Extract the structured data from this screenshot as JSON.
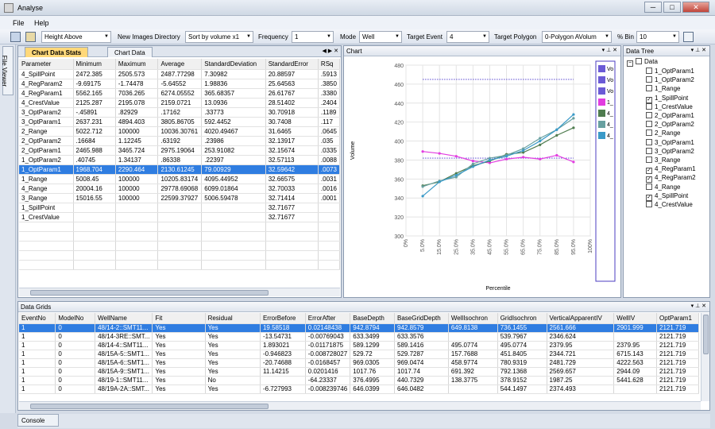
{
  "window": {
    "title": "Analyse",
    "min": "─",
    "max": "□",
    "close": "✕"
  },
  "menu": [
    "File",
    "Help"
  ],
  "toolbar": {
    "height_combo": "Height Above",
    "new_images_label": "New Images Directory",
    "sort_combo": "Sort by volume x1",
    "frequency_label": "Frequency",
    "frequency_combo": "1",
    "mode_label": "Mode",
    "mode_combo": "Well",
    "target_event_label": "Target Event",
    "target_event_combo": "4",
    "target_polygon_label": "Target Polygon",
    "target_polygon_combo": "0-Polygon AVolum",
    "bin_label": "% Bin",
    "bin_combo": "10"
  },
  "file_viewer": "File Viewer",
  "chart_data_panel": {
    "title": "Chart Data",
    "tabs": [
      "Chart Data Stats",
      "Chart Data"
    ],
    "columns": [
      "Parameter",
      "Minimum",
      "Maximum",
      "Average",
      "StandardDeviation",
      "StandardError",
      "RSq"
    ],
    "rows": [
      [
        "4_SpillPoint",
        "2472.385",
        "2505.573",
        "2487.77298",
        "7.30982",
        "20.88597",
        ".5913"
      ],
      [
        "4_RegParam2",
        "-9.69175",
        "-1.74478",
        "-5.64552",
        "1.98836",
        "25.64563",
        ".3850"
      ],
      [
        "4_RegParam1",
        "5562.165",
        "7036.265",
        "6274.05552",
        "365.68357",
        "26.61767",
        ".3380"
      ],
      [
        "4_CrestValue",
        "2125.287",
        "2195.078",
        "2159.0721",
        "13.0936",
        "28.51402",
        ".2404"
      ],
      [
        "3_OptParam2",
        "-.45891",
        ".82929",
        ".17162",
        ".33773",
        "30.70918",
        ".1189"
      ],
      [
        "3_OptParam1",
        "2637.231",
        "4894.403",
        "3805.86705",
        "592.4452",
        "30.7408",
        ".117"
      ],
      [
        "2_Range",
        "5022.712",
        "100000",
        "10036.30761",
        "4020.49467",
        "31.6465",
        ".0645"
      ],
      [
        "2_OptParam2",
        ".16684",
        "1.12245",
        ".63192",
        ".23986",
        "32.13917",
        ".035"
      ],
      [
        "2_OptParam1",
        "2465.988",
        "3465.724",
        "2975.19064",
        "253.91082",
        "32.15674",
        ".0335"
      ],
      [
        "1_OptParam2",
        ".40745",
        "1.34137",
        ".86338",
        ".22397",
        "32.57113",
        ".0088"
      ],
      [
        "1_OptParam1",
        "1968.704",
        "2290.464",
        "2130.61245",
        "79.00929",
        "32.59642",
        ".0073"
      ],
      [
        "1_Range",
        "5008.45",
        "100000",
        "10205.83174",
        "4095.44952",
        "32.66575",
        ".0031"
      ],
      [
        "4_Range",
        "20004.16",
        "100000",
        "29778.69068",
        "6099.01864",
        "32.70033",
        ".0016"
      ],
      [
        "3_Range",
        "15016.55",
        "100000",
        "22599.37927",
        "5006.59478",
        "32.71414",
        ".0001"
      ],
      [
        "1_SpillPoint",
        "",
        "",
        "",
        "",
        "32.71677",
        ""
      ],
      [
        "1_CrestValue",
        "",
        "",
        "",
        "",
        "32.71677",
        ""
      ]
    ],
    "selected_row": 10
  },
  "chart_panel": {
    "title": "Chart",
    "legend": [
      "Vo",
      "Vo",
      "Vo",
      "1_",
      "4_",
      "4_",
      "4_"
    ]
  },
  "chart_data": {
    "type": "line",
    "xlabel": "Percentile",
    "ylabel": "Volume",
    "x": [
      "0%",
      "5.0%",
      "15.0%",
      "25.0%",
      "35.0%",
      "45.0%",
      "55.0%",
      "65.0%",
      "75.0%",
      "85.0%",
      "95.0%",
      "100%"
    ],
    "ylim": [
      300,
      480
    ],
    "yticks": [
      300,
      320,
      340,
      360,
      380,
      400,
      420,
      440,
      460,
      480
    ],
    "series": [
      {
        "name": "Vo",
        "color": "#6b5bd6",
        "style": "dotted",
        "points": [
          [
            1,
            465
          ],
          [
            10,
            465
          ]
        ]
      },
      {
        "name": "Vo",
        "color": "#6b5bd6",
        "style": "dotted",
        "points": [
          [
            1,
            382
          ],
          [
            10,
            382
          ]
        ]
      },
      {
        "name": "1_",
        "color": "#e23ce0",
        "style": "solid",
        "points": [
          [
            1,
            389
          ],
          [
            2,
            387
          ],
          [
            3,
            384
          ],
          [
            4,
            379
          ],
          [
            5,
            377
          ],
          [
            6,
            381
          ],
          [
            7,
            383
          ],
          [
            8,
            381
          ],
          [
            9,
            385
          ],
          [
            10,
            378
          ]
        ]
      },
      {
        "name": "4_",
        "color": "#4f7c4f",
        "style": "solid",
        "points": [
          [
            1,
            353
          ],
          [
            2,
            357
          ],
          [
            3,
            366
          ],
          [
            4,
            374
          ],
          [
            5,
            379
          ],
          [
            6,
            386
          ],
          [
            7,
            388
          ],
          [
            8,
            396
          ],
          [
            9,
            406
          ],
          [
            10,
            414
          ]
        ]
      },
      {
        "name": "4_",
        "color": "#68a0a0",
        "style": "solid",
        "points": [
          [
            1,
            352
          ],
          [
            2,
            358
          ],
          [
            3,
            362
          ],
          [
            4,
            376
          ],
          [
            5,
            382
          ],
          [
            6,
            385
          ],
          [
            7,
            392
          ],
          [
            8,
            403
          ],
          [
            9,
            412
          ],
          [
            10,
            424
          ]
        ]
      },
      {
        "name": "4_",
        "color": "#3a9ac8",
        "style": "solid",
        "points": [
          [
            1,
            342
          ],
          [
            2,
            357
          ],
          [
            3,
            364
          ],
          [
            4,
            373
          ],
          [
            5,
            380
          ],
          [
            6,
            384
          ],
          [
            7,
            390
          ],
          [
            8,
            400
          ],
          [
            9,
            412
          ],
          [
            10,
            428
          ]
        ]
      }
    ],
    "grid": true,
    "legend_position": "right"
  },
  "tree_panel": {
    "title": "Data Tree",
    "root": "Data",
    "items": [
      {
        "label": "1_OptParam1",
        "checked": false
      },
      {
        "label": "1_OptParam2",
        "checked": false
      },
      {
        "label": "1_Range",
        "checked": false
      },
      {
        "label": "1_SpillPoint",
        "checked": true
      },
      {
        "label": "1_CrestValue",
        "checked": false
      },
      {
        "label": "2_OptParam1",
        "checked": false
      },
      {
        "label": "2_OptParam2",
        "checked": false
      },
      {
        "label": "2_Range",
        "checked": false
      },
      {
        "label": "3_OptParam1",
        "checked": false
      },
      {
        "label": "3_OptParam2",
        "checked": false
      },
      {
        "label": "3_Range",
        "checked": false
      },
      {
        "label": "4_RegParam1",
        "checked": true
      },
      {
        "label": "4_RegParam2",
        "checked": true
      },
      {
        "label": "4_Range",
        "checked": false
      },
      {
        "label": "4_SpillPoint",
        "checked": true
      },
      {
        "label": "4_CrestValue",
        "checked": false
      }
    ]
  },
  "grids_panel": {
    "title": "Data Grids",
    "columns": [
      "EventNo",
      "ModelNo",
      "WellName",
      "Fit",
      "Residual",
      "ErrorBefore",
      "ErrorAfter",
      "BaseDepth",
      "BaseGridDepth",
      "WellIsochron",
      "GridIsochron",
      "VerticalApparentIV",
      "WellIV",
      "OptParam1"
    ],
    "rows": [
      [
        "1",
        "0",
        "48/14-2::SMT11...",
        "Yes",
        "Yes",
        "19.58518",
        "0.02148438",
        "942.8794",
        "942.8579",
        "649.8138",
        "736.1455",
        "2561.666",
        "2901.999",
        "2121.719"
      ],
      [
        "1",
        "0",
        "48/14-3RE::SMT...",
        "Yes",
        "Yes",
        "-13.54731",
        "-0.00769043",
        "633.3499",
        "633.3576",
        "",
        "539.7967",
        "2346.624",
        "",
        "2121.719"
      ],
      [
        "1",
        "0",
        "48/14-4::SMT11...",
        "Yes",
        "Yes",
        "1.893021",
        "-0.01171875",
        "589.1299",
        "589.1416",
        "495.0774",
        "495.0774",
        "2379.95",
        "2379.95",
        "2121.719"
      ],
      [
        "1",
        "0",
        "48/15A-5::SMT1...",
        "Yes",
        "Yes",
        "-0.946823",
        "-0.008728027",
        "529.72",
        "529.7287",
        "157.7688",
        "451.8405",
        "2344.721",
        "6715.143",
        "2121.719"
      ],
      [
        "1",
        "0",
        "48/15A-6::SMT1...",
        "Yes",
        "Yes",
        "-20.74688",
        "-0.0168457",
        "969.0305",
        "969.0474",
        "458.9774",
        "780.9319",
        "2481.729",
        "4222.563",
        "2121.719"
      ],
      [
        "1",
        "0",
        "48/15A-9::SMT1...",
        "Yes",
        "Yes",
        "11.14215",
        "0.0201416",
        "1017.76",
        "1017.74",
        "691.392",
        "792.1368",
        "2569.657",
        "2944.09",
        "2121.719"
      ],
      [
        "1",
        "0",
        "48/19-1::SMT11...",
        "Yes",
        "No",
        "",
        "-64.23337",
        "376.4995",
        "440.7329",
        "138.3775",
        "378.9152",
        "1987.25",
        "5441.628",
        "2121.719"
      ],
      [
        "1",
        "0",
        "48/19A-2A::SMT...",
        "Yes",
        "Yes",
        "-6.727993",
        "-0.008239746",
        "646.0399",
        "646.0482",
        "",
        "544.1497",
        "2374.493",
        "",
        "2121.719"
      ]
    ],
    "selected_row": 0
  },
  "console": {
    "label": "Console"
  }
}
